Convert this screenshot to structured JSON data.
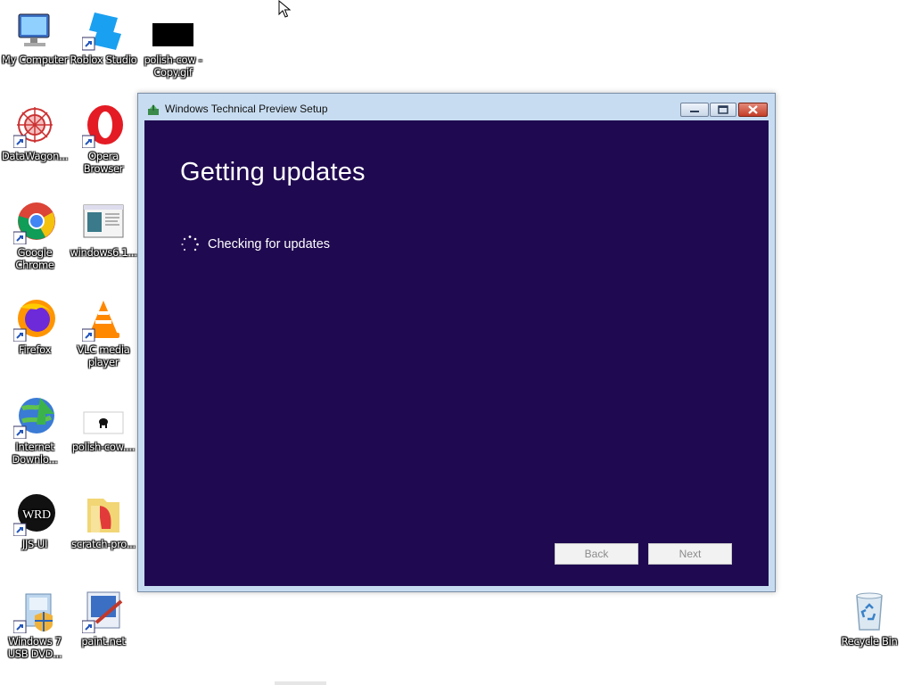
{
  "desktop": {
    "icons": [
      {
        "id": "my-computer",
        "label": "My Computer",
        "icon": "computer-icon"
      },
      {
        "id": "roblox-studio",
        "label": "Roblox Studio",
        "icon": "roblox-studio-icon"
      },
      {
        "id": "polish-cow-copy",
        "label": "polish-cow - Copy.gif",
        "icon": "gif-file-icon"
      },
      {
        "id": "datawagon",
        "label": "DataWagon...",
        "icon": "datawagon-icon"
      },
      {
        "id": "opera",
        "label": "Opera Browser",
        "icon": "opera-icon"
      },
      {
        "id": "google-chrome",
        "label": "Google Chrome",
        "icon": "chrome-icon"
      },
      {
        "id": "windows61",
        "label": "windows6.1...",
        "icon": "installer-file-icon"
      },
      {
        "id": "firefox",
        "label": "Firefox",
        "icon": "firefox-icon"
      },
      {
        "id": "vlc",
        "label": "VLC media player",
        "icon": "vlc-icon"
      },
      {
        "id": "internet-download",
        "label": "Internet Downlo...",
        "icon": "internet-download-manager-icon"
      },
      {
        "id": "polish-cow",
        "label": "polish-cow....",
        "icon": "gif-file-icon"
      },
      {
        "id": "jjs-ui",
        "label": "JJS-UI",
        "icon": "jjs-ui-icon"
      },
      {
        "id": "scratch-pro",
        "label": "scratch-pro...",
        "icon": "folder-icon"
      },
      {
        "id": "win7-usb",
        "label": "Windows 7 USB DVD...",
        "icon": "usb-dvd-tool-icon"
      },
      {
        "id": "paintnet",
        "label": "paint.net",
        "icon": "paintnet-icon"
      },
      {
        "id": "recycle-bin",
        "label": "Recycle Bin",
        "icon": "recycle-bin-icon"
      }
    ]
  },
  "window": {
    "title": "Windows Technical Preview Setup",
    "heading": "Getting updates",
    "status_text": "Checking for updates",
    "back_label": "Back",
    "next_label": "Next",
    "colors": {
      "background": "#1f0950",
      "frame": "#c7dcf0"
    }
  }
}
